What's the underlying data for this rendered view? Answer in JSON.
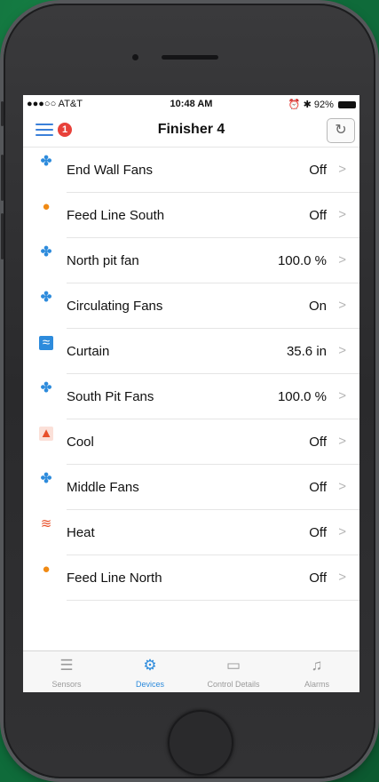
{
  "status": {
    "carrier": "●●●○○ AT&T",
    "time": "10:48 AM",
    "battery": "92%"
  },
  "nav": {
    "title": "Finisher 4",
    "badge_count": "1"
  },
  "devices": [
    {
      "icon": "fan-icon",
      "name": "End Wall Fans",
      "value": "Off"
    },
    {
      "icon": "feeder-icon",
      "name": "Feed Line South",
      "value": "Off"
    },
    {
      "icon": "fan-icon",
      "name": "North pit fan",
      "value": "100.0 %"
    },
    {
      "icon": "fan-icon",
      "name": "Circulating Fans",
      "value": "On"
    },
    {
      "icon": "curtain-icon",
      "name": "Curtain",
      "value": "35.6 in"
    },
    {
      "icon": "fan-icon",
      "name": "South Pit Fans",
      "value": "100.0 %"
    },
    {
      "icon": "cool-icon",
      "name": "Cool",
      "value": "Off"
    },
    {
      "icon": "fan-icon",
      "name": "Middle Fans",
      "value": "Off"
    },
    {
      "icon": "heat-icon",
      "name": "Heat",
      "value": "Off"
    },
    {
      "icon": "feeder-icon",
      "name": "Feed Line North",
      "value": "Off"
    }
  ],
  "tabs": [
    {
      "icon": "sliders-icon",
      "label": "Sensors"
    },
    {
      "icon": "gear-icon",
      "label": "Devices"
    },
    {
      "icon": "monitor-icon",
      "label": "Control Details"
    },
    {
      "icon": "bell-icon",
      "label": "Alarms"
    }
  ],
  "colors": {
    "accent": "#2d8bdc",
    "badge": "#e8413a",
    "feeder": "#f08a14"
  }
}
